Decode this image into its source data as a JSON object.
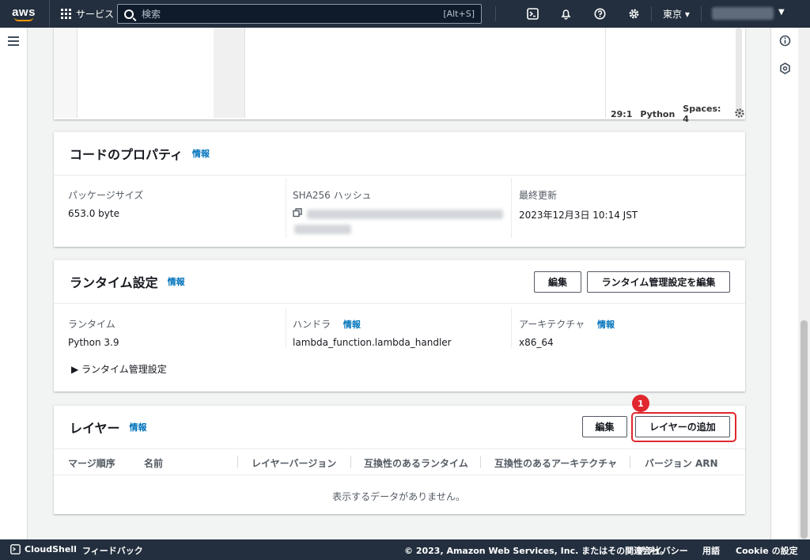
{
  "topnav": {
    "logo": "aws",
    "services_label": "サービス",
    "search_placeholder": "検索",
    "search_shortcut": "[Alt+S]",
    "region": "東京 ▾",
    "account_caret": "▼"
  },
  "editor": {
    "cursor_pos": "29:1",
    "language": "Python",
    "spaces": "Spaces: 4"
  },
  "code_properties": {
    "title": "コードのプロパティ",
    "info": "情報",
    "package_size_label": "パッケージサイズ",
    "package_size_value": "653.0 byte",
    "sha_label": "SHA256 ハッシュ",
    "last_modified_label": "最終更新",
    "last_modified_value": "2023年12月3日 10:14 JST"
  },
  "runtime_settings": {
    "title": "ランタイム設定",
    "info": "情報",
    "edit_button": "編集",
    "edit_runtime_mgmt_button": "ランタイム管理設定を編集",
    "runtime_label": "ランタイム",
    "runtime_value": "Python 3.9",
    "handler_label": "ハンドラ",
    "handler_info": "情報",
    "handler_value": "lambda_function.lambda_handler",
    "arch_label": "アーキテクチャ",
    "arch_info": "情報",
    "arch_value": "x86_64",
    "runtime_mgmt_toggle": "▶ ランタイム管理設定"
  },
  "layers": {
    "title": "レイヤー",
    "info": "情報",
    "edit_button": "編集",
    "add_button": "レイヤーの追加",
    "marker": "1",
    "columns": [
      "マージ順序",
      "名前",
      "レイヤーバージョン",
      "互換性のあるランタイム",
      "互換性のあるアーキテクチャ",
      "バージョン ARN"
    ],
    "empty_message": "表示するデータがありません。"
  },
  "footer": {
    "cloudshell": "CloudShell",
    "feedback": "フィードバック",
    "copyright": "© 2023, Amazon Web Services, Inc. またはその関連会社。",
    "privacy": "プライバシー",
    "terms": "用語",
    "cookie": "Cookie の設定"
  }
}
